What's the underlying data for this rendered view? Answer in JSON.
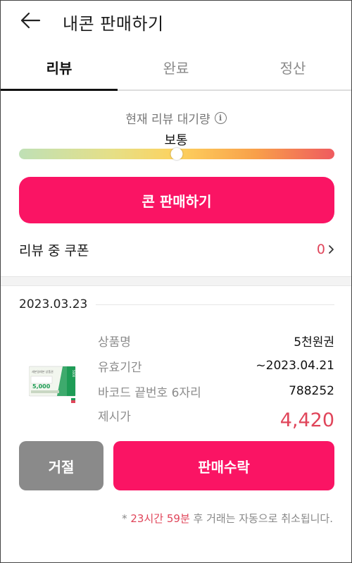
{
  "header": {
    "title": "내콘 판매하기",
    "back_icon": "arrow-left-icon"
  },
  "tabs": [
    {
      "label": "리뷰",
      "active": true
    },
    {
      "label": "완료",
      "active": false
    },
    {
      "label": "정산",
      "active": false
    }
  ],
  "wait": {
    "label": "현재 리뷰 대기량",
    "info_icon": "info-icon",
    "info_glyph": "i",
    "level": "보통",
    "gauge_fraction": 0.5,
    "gauge_colors": [
      "#bfe0b6",
      "#e6df86",
      "#fdd25e",
      "#f8a04a",
      "#ef5b5f"
    ]
  },
  "sell_button": {
    "label": "콘 판매하기",
    "color": "#fa1464"
  },
  "coupon": {
    "label": "리뷰 중 쿠폰",
    "count": "0",
    "chevron_icon": "chevron-right-icon"
  },
  "item": {
    "date": "2023.03.23",
    "card": {
      "brand_text": "세븐일레븐 상품권",
      "amount_text": "5,000",
      "side_text": "5000"
    },
    "details": [
      {
        "label": "상품명",
        "value": "5천원권"
      },
      {
        "label": "유효기간",
        "value": "~2023.04.21"
      },
      {
        "label": "바코드 끝번호 6자리",
        "value": "788252"
      }
    ],
    "price": {
      "label": "제시가",
      "value": "4,420"
    }
  },
  "actions": {
    "reject_label": "거절",
    "accept_label": "판매수락"
  },
  "notice": {
    "prefix": "* ",
    "hours": "23시간",
    "space": " ",
    "minutes": "59분",
    "suffix": " 후 거래는 자동으로 취소됩니다."
  },
  "colors": {
    "accent": "#fa1464",
    "price": "#e0455a",
    "reject": "#8a8a8a"
  }
}
